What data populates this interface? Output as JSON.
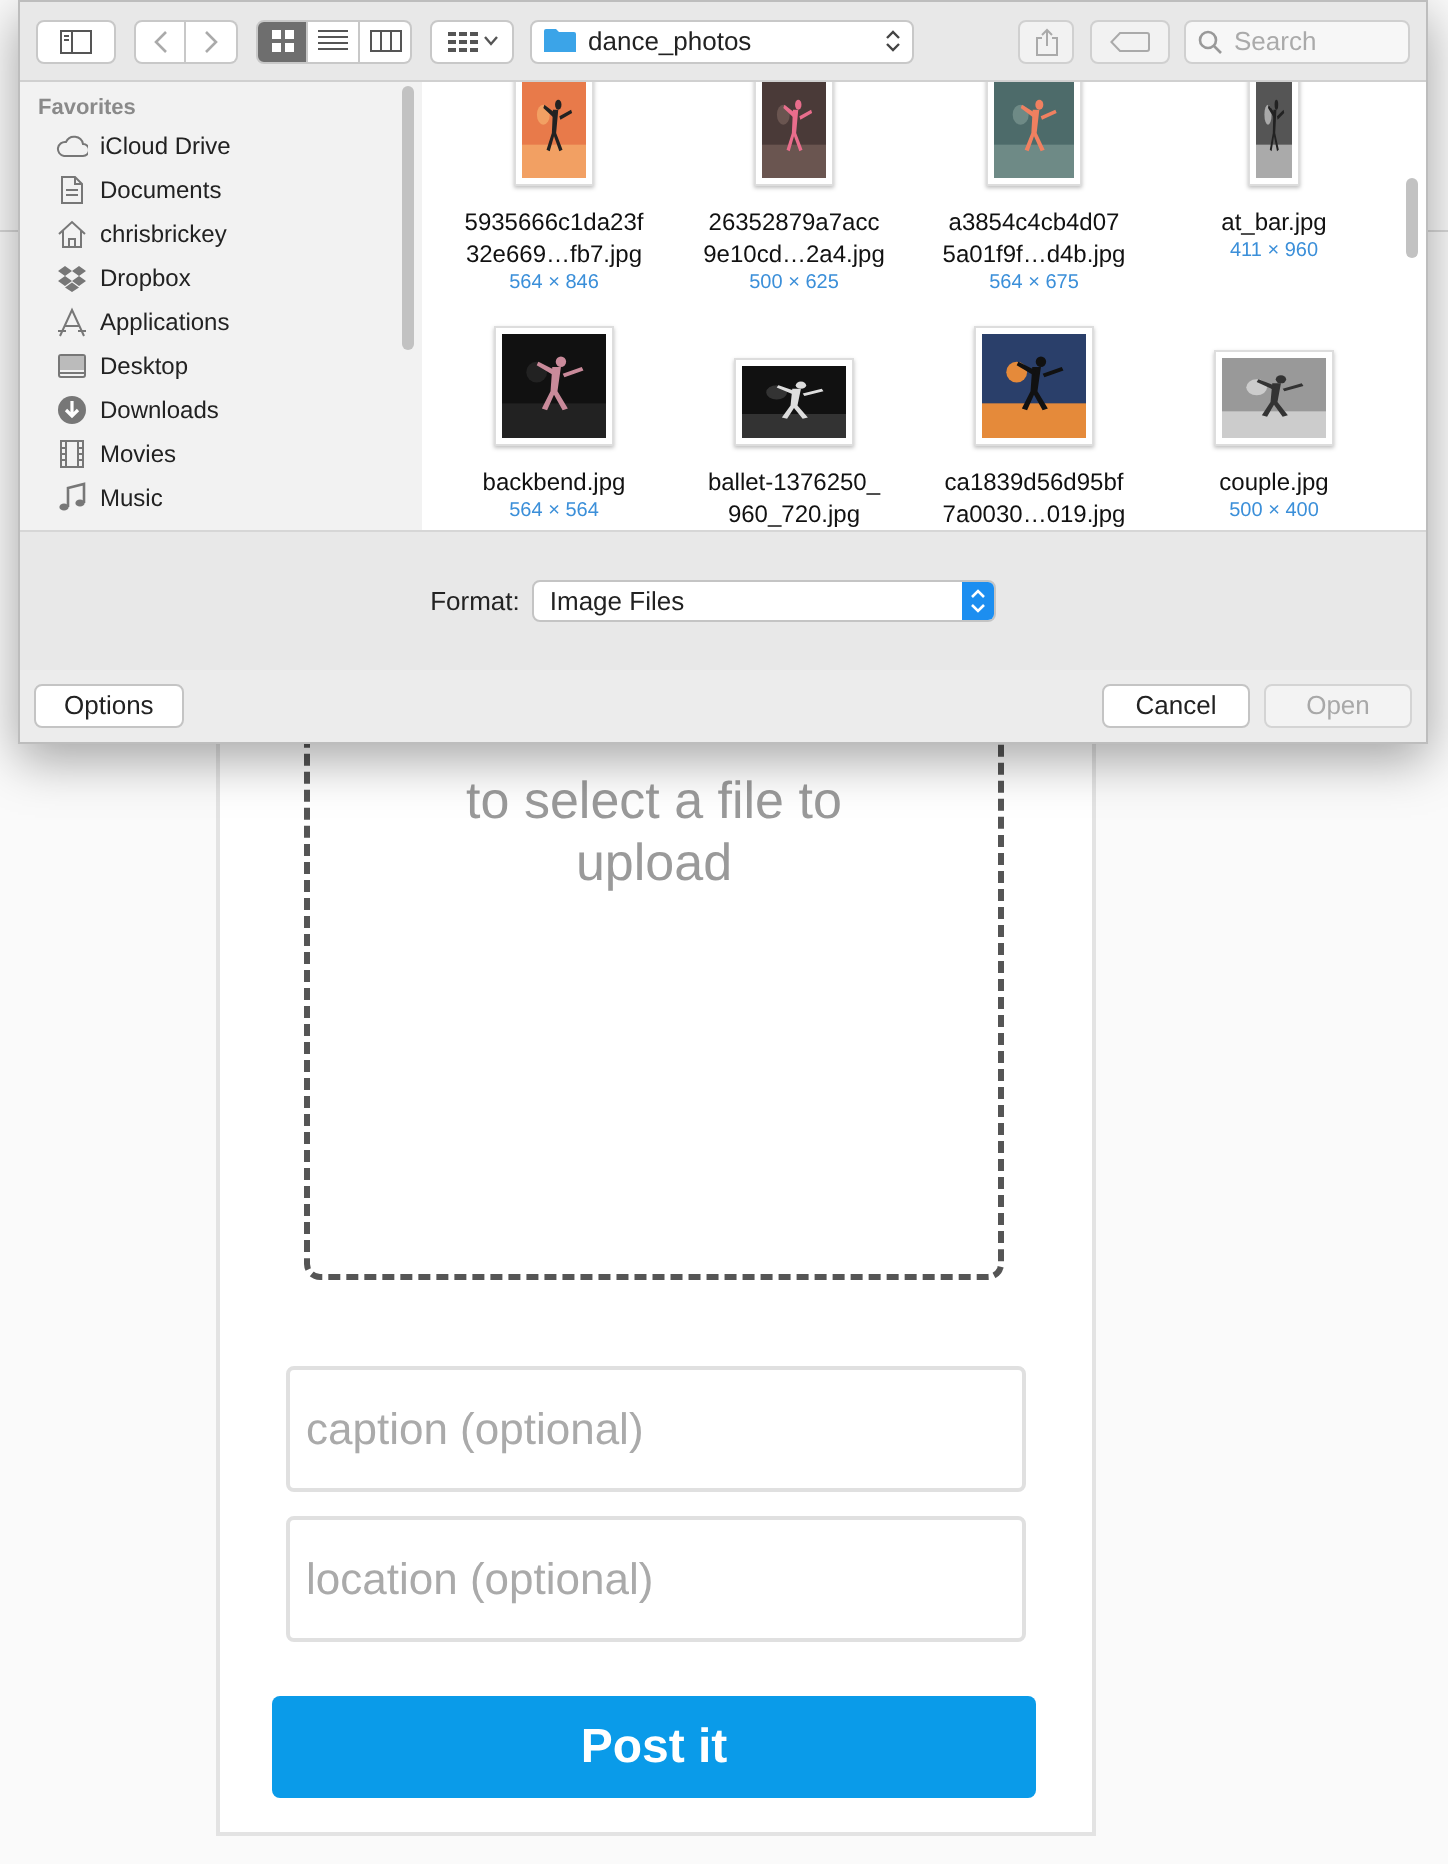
{
  "dialog": {
    "toolbar": {
      "view_modes": [
        {
          "selected": true
        },
        {
          "selected": false
        },
        {
          "selected": false
        }
      ],
      "location": "dance_photos",
      "search": {
        "placeholder": "Search"
      }
    },
    "sidebar": {
      "heading": "Favorites",
      "items": [
        {
          "label": "iCloud Drive"
        },
        {
          "label": "Documents"
        },
        {
          "label": "chrisbrickey"
        },
        {
          "label": "Dropbox"
        },
        {
          "label": "Applications"
        },
        {
          "label": "Desktop"
        },
        {
          "label": "Downloads"
        },
        {
          "label": "Movies"
        },
        {
          "label": "Music"
        }
      ]
    },
    "files": [
      {
        "name": "5935666c1da23f\n32e669…fb7.jpg",
        "dimensions": "564 × 846"
      },
      {
        "name": "26352879a7acc\n9e10cd…2a4.jpg",
        "dimensions": "500 × 625"
      },
      {
        "name": "a3854c4cb4d07\n5a01f9f…d4b.jpg",
        "dimensions": "564 × 675"
      },
      {
        "name": "at_bar.jpg",
        "dimensions": "411 × 960"
      },
      {
        "name": "backbend.jpg",
        "dimensions": "564 × 564"
      },
      {
        "name": "ballet-1376250_\n960_720.jpg"
      },
      {
        "name": "ca1839d56d95bf\n7a0030…019.jpg"
      },
      {
        "name": "couple.jpg",
        "dimensions": "500 × 400"
      }
    ],
    "format": {
      "label": "Format:",
      "value": "Image Files"
    },
    "buttons": [
      {
        "label": "Options",
        "disabled": false
      },
      {
        "label": "Cancel",
        "disabled": false
      },
      {
        "label": "Open",
        "disabled": true
      }
    ]
  },
  "upload": {
    "drop_text": "to select a file to upload",
    "caption": {
      "placeholder": "caption (optional)"
    },
    "location": {
      "placeholder": "location (optional)"
    },
    "submit": "Post it"
  }
}
